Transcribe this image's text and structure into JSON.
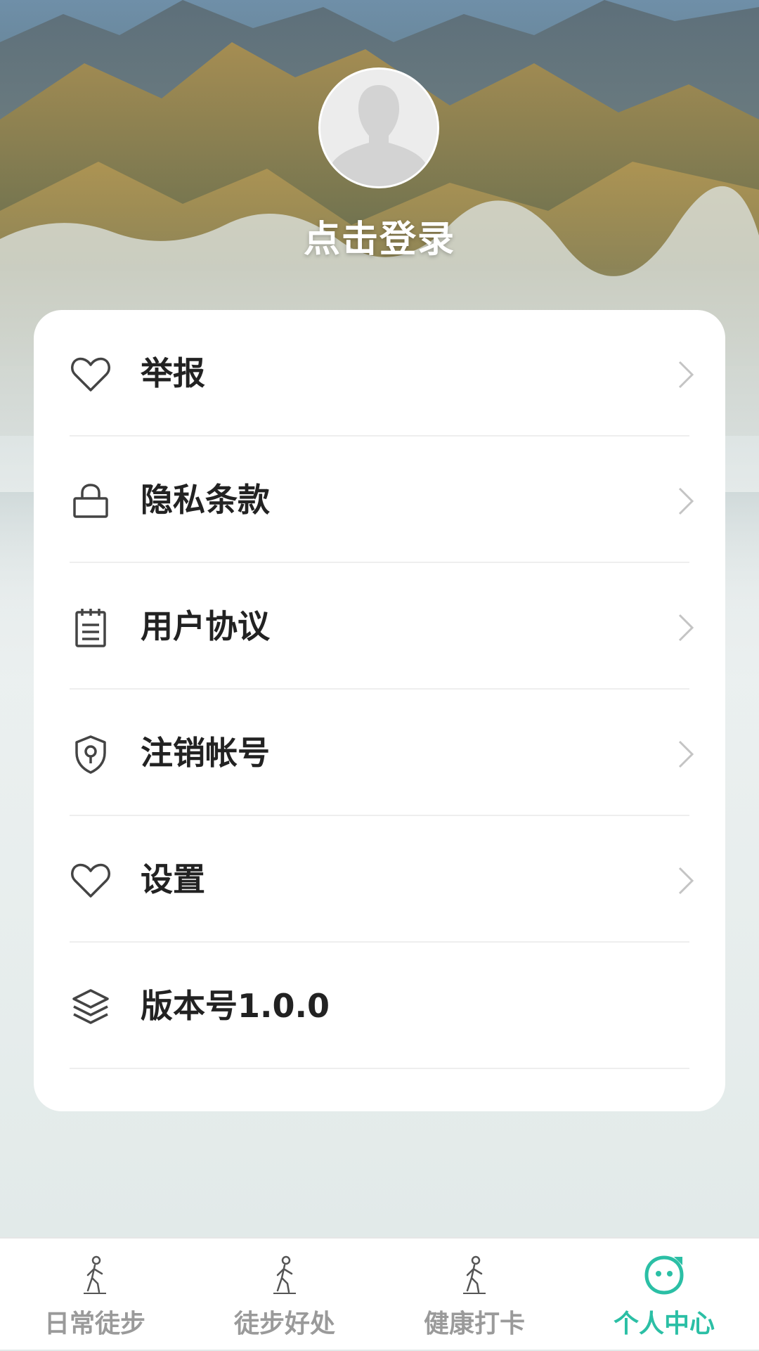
{
  "header": {
    "login_text": "点击登录"
  },
  "menu": {
    "items": [
      {
        "label": "举报",
        "icon": "heart-icon",
        "has_chevron": true
      },
      {
        "label": "隐私条款",
        "icon": "lock-icon",
        "has_chevron": true
      },
      {
        "label": "用户协议",
        "icon": "notepad-icon",
        "has_chevron": true
      },
      {
        "label": "注销帐号",
        "icon": "shield-icon",
        "has_chevron": true
      },
      {
        "label": "设置",
        "icon": "heart-icon",
        "has_chevron": true
      },
      {
        "label": "版本号1.0.0",
        "icon": "layers-icon",
        "has_chevron": false
      }
    ]
  },
  "tabbar": {
    "tabs": [
      {
        "label": "日常徒步",
        "icon": "walker-icon",
        "active": false
      },
      {
        "label": "徒步好处",
        "icon": "walker-icon",
        "active": false
      },
      {
        "label": "健康打卡",
        "icon": "walker-icon",
        "active": false
      },
      {
        "label": "个人中心",
        "icon": "smiley-face-icon",
        "active": true
      }
    ]
  },
  "colors": {
    "accent": "#2bbfa5",
    "inactive_tab": "#9a9a9a",
    "menu_text": "#222222",
    "card_background": "#ffffff"
  }
}
